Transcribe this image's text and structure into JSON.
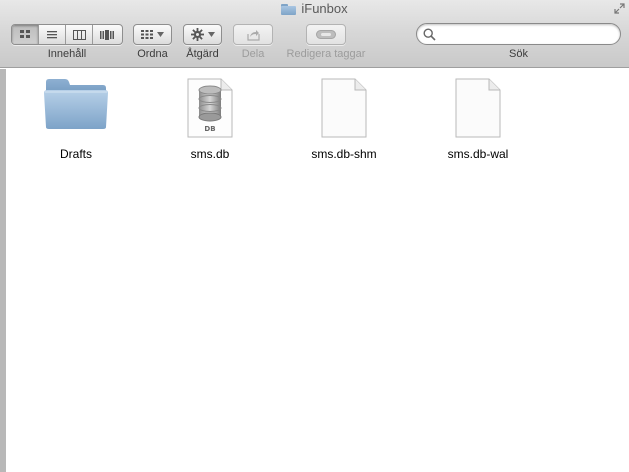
{
  "window": {
    "title": "iFunbox"
  },
  "toolbar": {
    "view_label": "Innehåll",
    "arrange_label": "Ordna",
    "action_label": "Åtgärd",
    "share_label": "Dela",
    "tags_label": "Redigera taggar",
    "search_label": "Sök",
    "search_value": ""
  },
  "files": [
    {
      "name": "Drafts",
      "icon": "folder-icon"
    },
    {
      "name": "sms.db",
      "icon": "database-file-icon"
    },
    {
      "name": "sms.db-shm",
      "icon": "blank-document-icon"
    },
    {
      "name": "sms.db-wal",
      "icon": "blank-document-icon"
    }
  ],
  "db_badge": "DB",
  "colors": {
    "folder": "#8fb3d6",
    "toolbar": "#d8d8d8"
  }
}
